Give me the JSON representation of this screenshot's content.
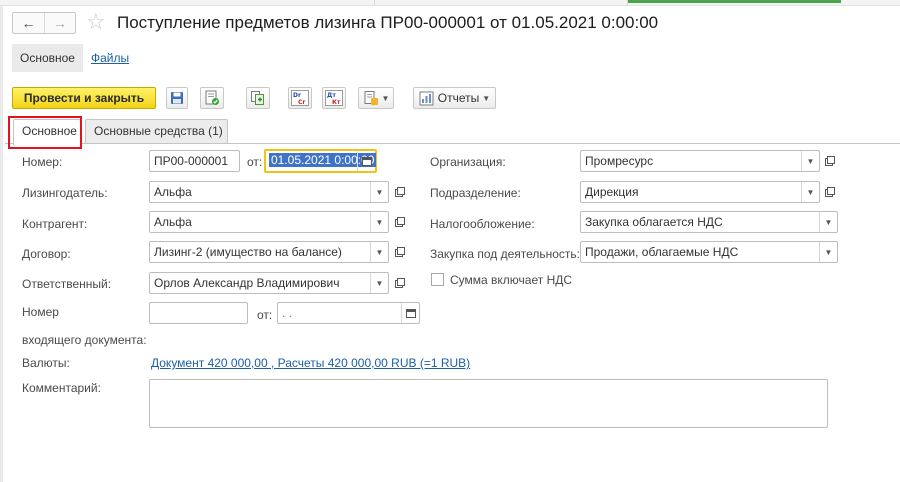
{
  "window": {
    "title": "Поступление предметов лизинга ПР00-000001 от 01.05.2021 0:00:00"
  },
  "sections": {
    "main_label": "Основное",
    "files_label": "Файлы"
  },
  "toolbar": {
    "post_and_close_label": "Провести и закрыть",
    "reports_label": "Отчеты"
  },
  "tabs": {
    "main_label": "Основное",
    "fixed_assets_label": "Основные средства (1)"
  },
  "form": {
    "number_label": "Номер:",
    "number_value": "ПР00-000001",
    "date_prefix": "от:",
    "date_value": "01.05.2021  0:00:00",
    "lessor_label": "Лизингодатель:",
    "lessor_value": "Альфа",
    "counterparty_label": "Контрагент:",
    "counterparty_value": "Альфа",
    "contract_label": "Договор:",
    "contract_value": "Лизинг-2 (имущество на балансе)",
    "responsible_label": "Ответственный:",
    "responsible_value": "Орлов Александр Владимирович",
    "incoming_number_label_line1": "Номер",
    "incoming_number_label_line2": "входящего документа:",
    "incoming_number_value": "",
    "incoming_date_prefix": "от:",
    "incoming_date_value": "  .  .",
    "currency_label": "Валюты:",
    "currency_link": "Документ 420 000,00 , Расчеты 420 000,00 RUB (=1 RUB)",
    "comment_label": "Комментарий:",
    "comment_value": "",
    "organization_label": "Организация:",
    "organization_value": "Промресурс",
    "department_label": "Подразделение:",
    "department_value": "Дирекция",
    "taxation_label": "Налогообложение:",
    "taxation_value": "Закупка облагается НДС",
    "activity_label": "Закупка под деятельность:",
    "activity_value": "Продажи, облагаемые НДС",
    "vat_included_label": "Сумма включает НДС",
    "vat_included_checked": false
  },
  "colors": {
    "primary_button": "#f2d414",
    "link": "#1b5fa8",
    "tab_highlight": "#e0141a",
    "focus_border": "#f2c315",
    "selection": "#3f73c8"
  },
  "icons": {
    "back": "arrow-left-icon",
    "forward": "arrow-right-icon",
    "favorite": "star-icon",
    "save": "floppy-disk-icon",
    "post": "post-document-icon",
    "create_based_on": "create-based-on-icon",
    "dr_cr": "dr-cr-icon",
    "dt_kt": "dt-kt-icon",
    "attachment": "document-attachment-icon",
    "reports": "reports-icon",
    "open": "open-link-icon",
    "calendar": "calendar-icon",
    "dropdown": "chevron-down-icon"
  }
}
